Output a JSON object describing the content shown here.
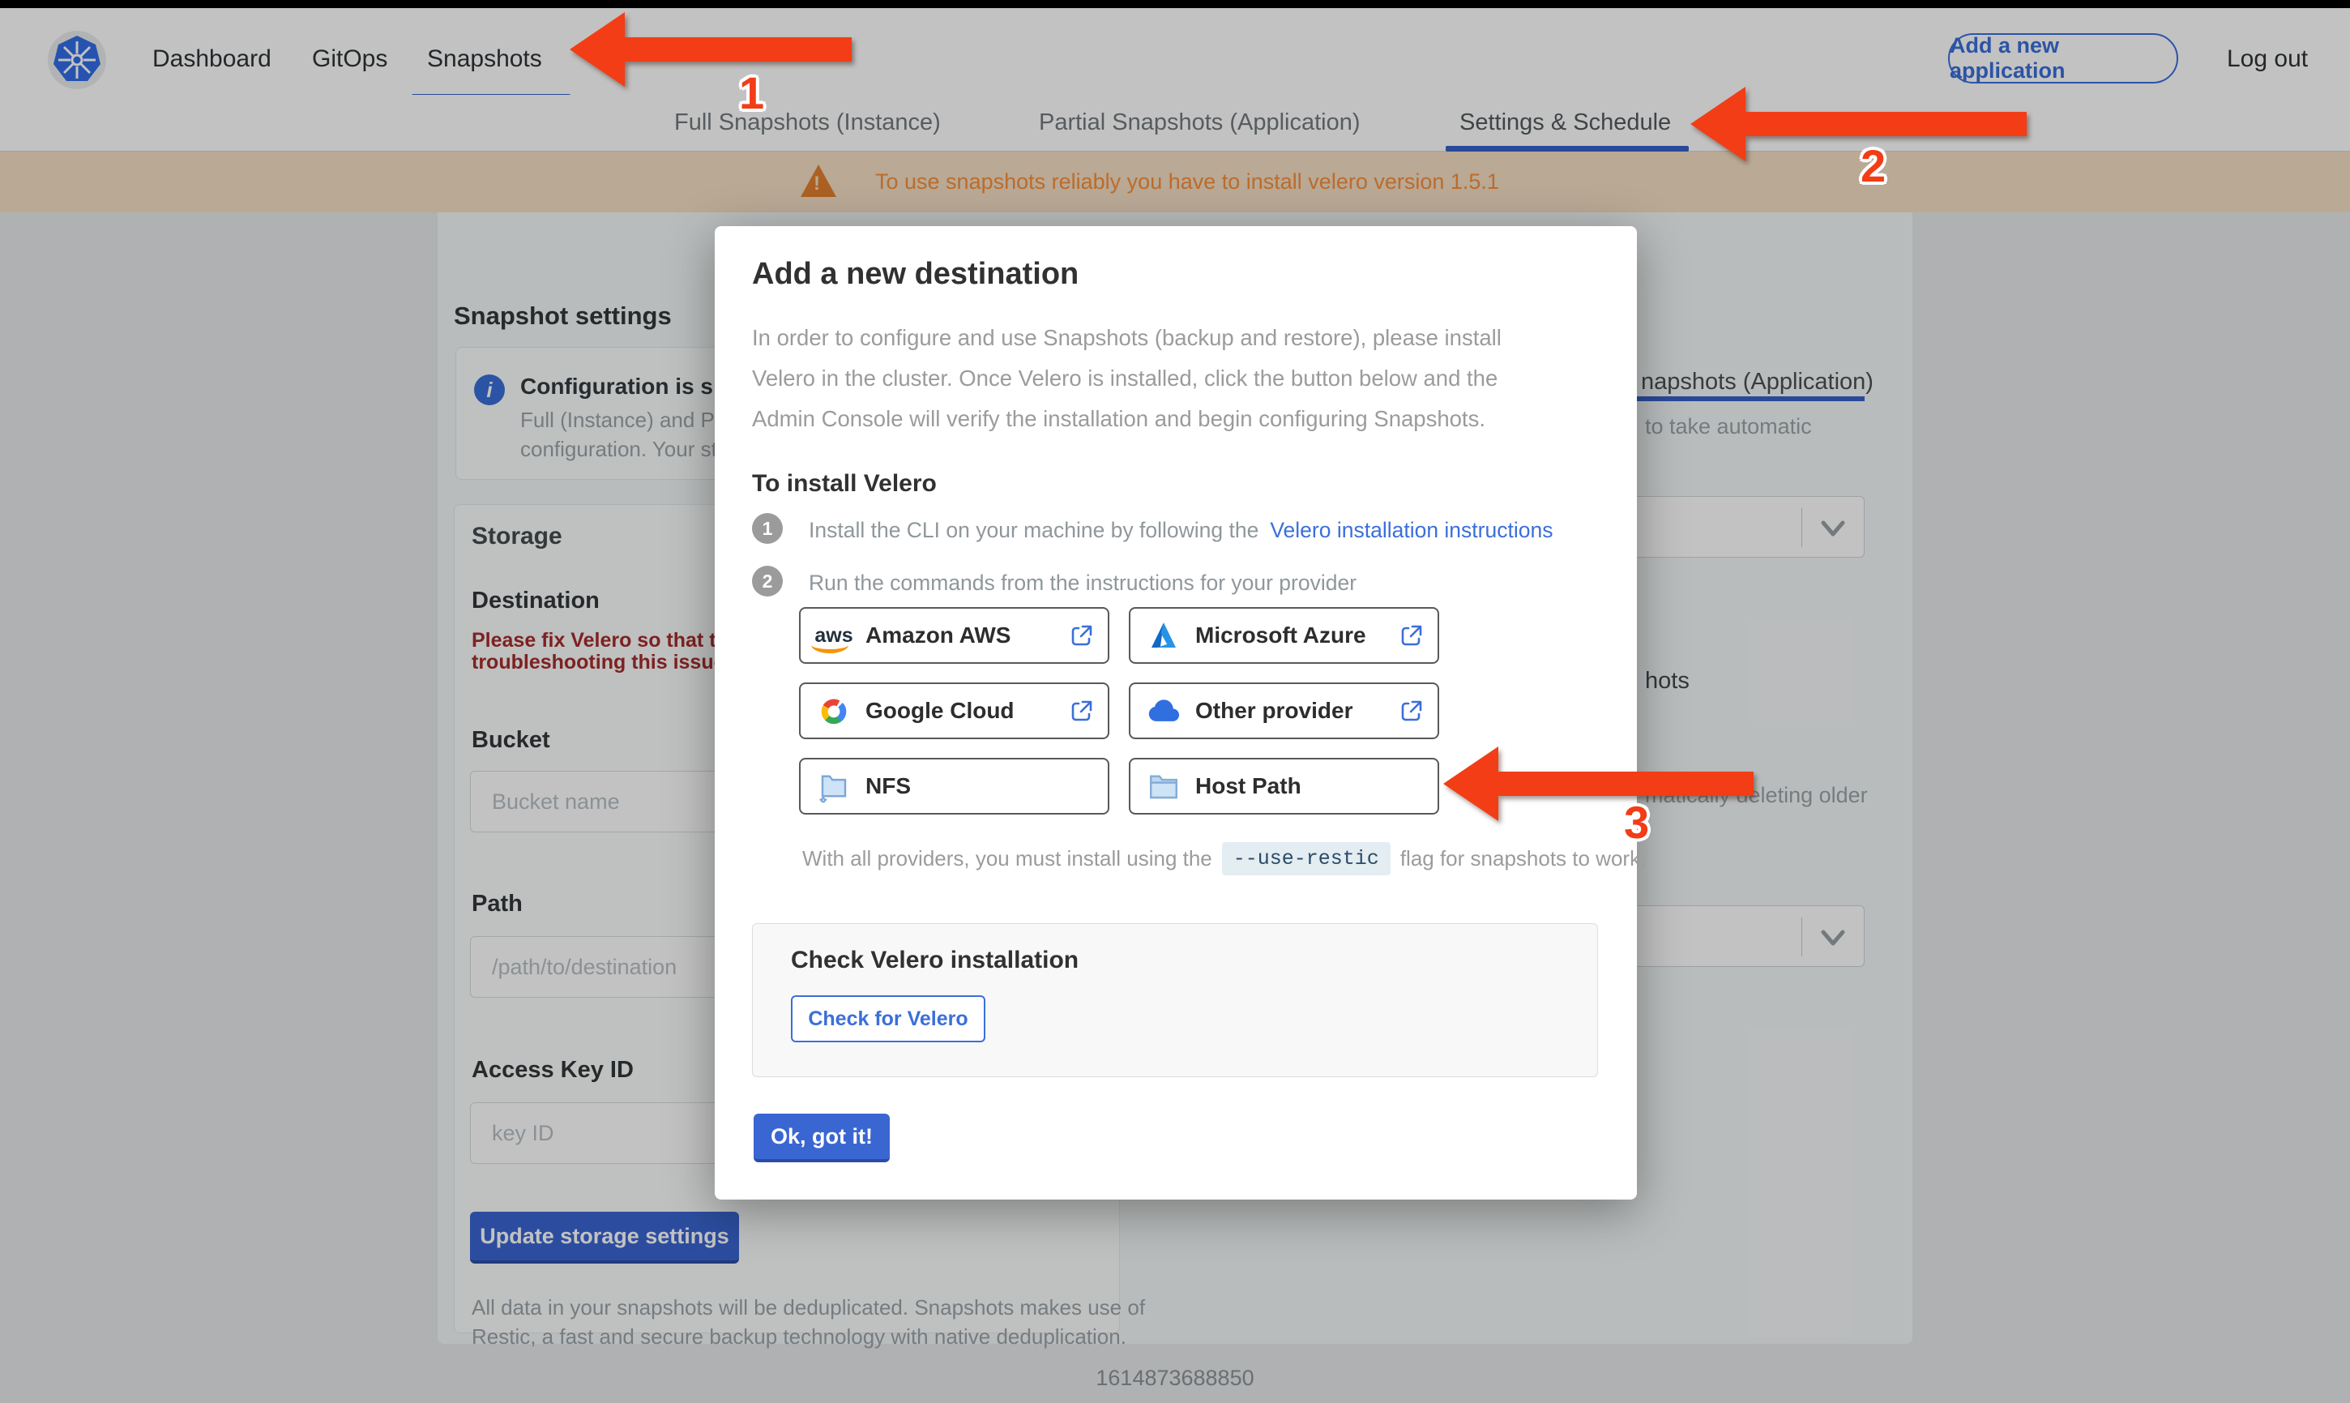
{
  "topnav": {
    "brand_icon": "kubernetes-logo",
    "items": [
      {
        "label": "Dashboard"
      },
      {
        "label": "GitOps"
      },
      {
        "label": "Snapshots"
      }
    ],
    "add_app_label": "Add a new application",
    "logout_label": "Log out"
  },
  "subnav": {
    "tabs": [
      {
        "label": "Full Snapshots (Instance)"
      },
      {
        "label": "Partial Snapshots (Application)"
      },
      {
        "label": "Settings & Schedule"
      }
    ]
  },
  "banner": {
    "icon": "warning-icon",
    "text": "To use snapshots reliably you have to install velero version 1.5.1"
  },
  "page": {
    "heading": "Snapshot settings",
    "info_box": {
      "title_fragment": "Configuration is sh",
      "line1_fragment": "Full (Instance) and Parti",
      "line2_fragment": "configuration. Your stor"
    },
    "storage": {
      "heading": "Storage",
      "destination_label": "Destination",
      "error_line1": "Please fix Velero so that th",
      "error_line2": "troubleshooting this issue",
      "bucket_label": "Bucket",
      "bucket_placeholder": "Bucket name",
      "path_label": "Path",
      "path_placeholder": "/path/to/destination",
      "access_key_label": "Access Key ID",
      "access_key_placeholder": "key ID",
      "update_button": "Update storage settings",
      "footer_line1": "All data in your snapshots will be deduplicated. Snapshots makes use of",
      "footer_line2": "Restic, a fast and secure backup technology with native deduplication."
    },
    "schedule_fragments": {
      "tab_fragment": "napshots (Application)",
      "auto_fragment": "to take automatic",
      "retention_fragment": "hots",
      "deleting_fragment": "matically deleting older"
    },
    "timestamp": "1614873688850"
  },
  "modal": {
    "title": "Add a new destination",
    "intro_line1": "In order to configure and use Snapshots (backup and restore), please install",
    "intro_line2": "Velero in the cluster. Once Velero is installed, click the button below and the",
    "intro_line3": "Admin Console will verify the installation and begin configuring Snapshots.",
    "install_heading": "To install Velero",
    "step1_num": "1",
    "step1_text": "Install the CLI on your machine by following the",
    "step1_link": "Velero installation instructions",
    "step2_num": "2",
    "step2_text": "Run the commands from the instructions for your provider",
    "providers": [
      {
        "label": "Amazon AWS",
        "icon": "aws-icon"
      },
      {
        "label": "Microsoft Azure",
        "icon": "azure-icon"
      },
      {
        "label": "Google Cloud",
        "icon": "google-cloud-icon"
      },
      {
        "label": "Other provider",
        "icon": "cloud-icon"
      },
      {
        "label": "NFS",
        "icon": "nfs-folder-icon"
      },
      {
        "label": "Host Path",
        "icon": "folder-icon"
      }
    ],
    "restic_before": "With all providers, you must install using the",
    "restic_code": "--use-restic",
    "restic_after": "flag for snapshots to work.",
    "check_box": {
      "heading": "Check Velero installation",
      "button": "Check for Velero"
    },
    "ok_button": "Ok, got it!"
  },
  "annotations": {
    "num1": "1",
    "num2": "2",
    "num3": "3"
  },
  "colors": {
    "accent_blue": "#3b6fd9",
    "warning_orange": "#f78e3b",
    "error_red": "#a62c2c",
    "annotation_red": "#f23d16"
  }
}
